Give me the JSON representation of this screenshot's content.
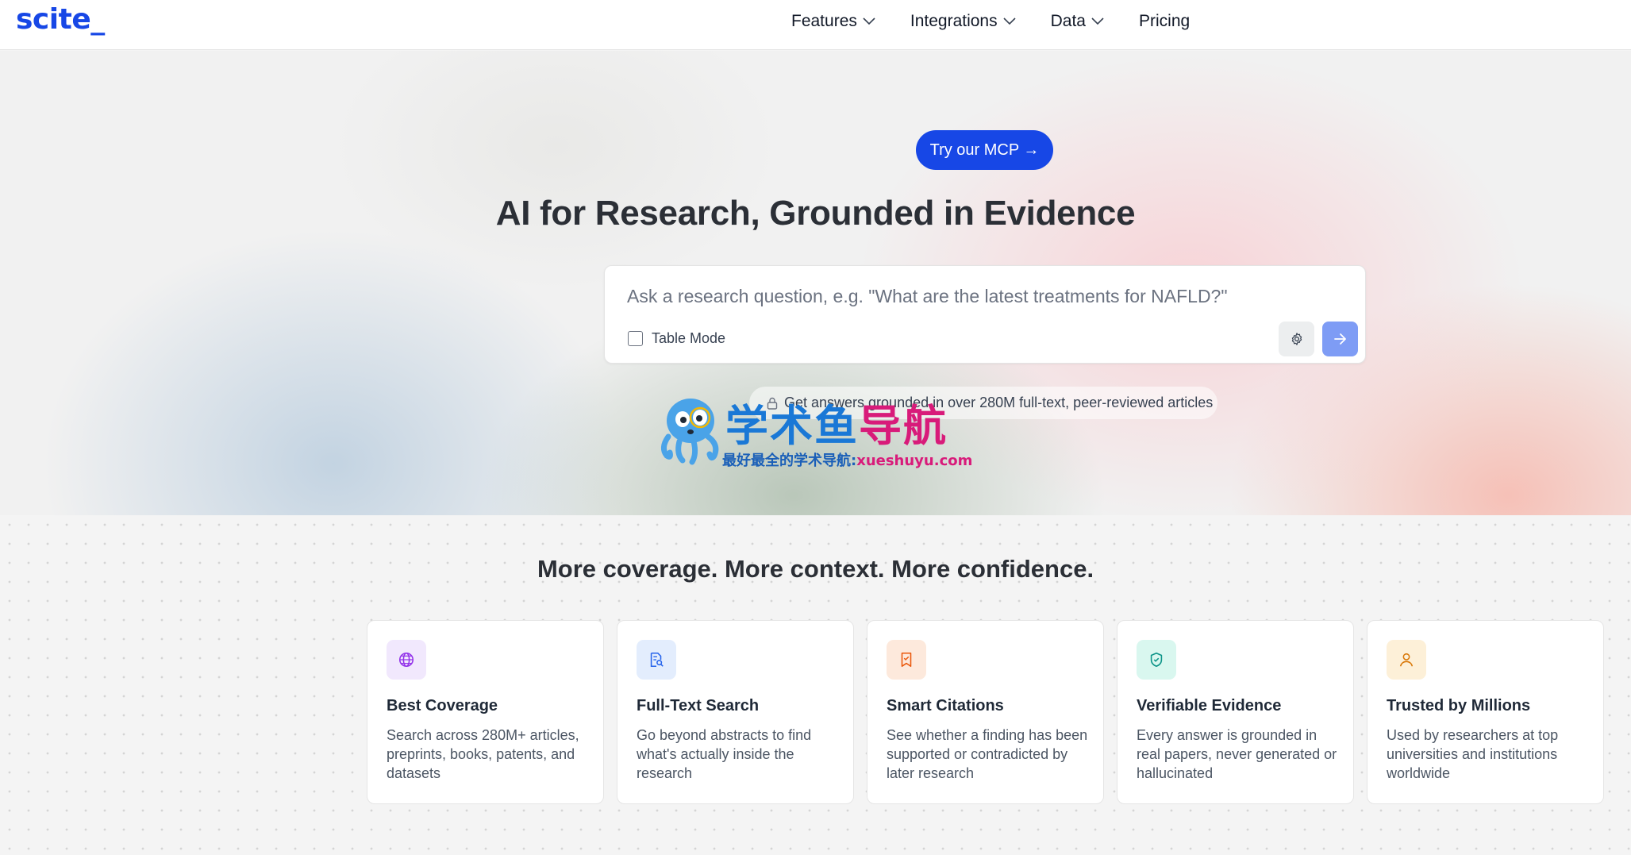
{
  "brand": {
    "logo": "scite_",
    "color": "#1747e6"
  },
  "nav": {
    "items": [
      {
        "label": "Features",
        "has_dropdown": true
      },
      {
        "label": "Integrations",
        "has_dropdown": true
      },
      {
        "label": "Data",
        "has_dropdown": true
      },
      {
        "label": "Pricing",
        "has_dropdown": false
      }
    ]
  },
  "hero": {
    "cta_label": "Try our MCP →",
    "title": "AI for Research, Grounded in Evidence",
    "search": {
      "value": "",
      "placeholder": "Ask a research question, e.g. \"What are the latest treatments for NAFLD?\""
    },
    "table_mode_label": "Table Mode",
    "table_mode_checked": false,
    "settings_icon": "gear-icon",
    "submit_icon": "arrow-right-icon",
    "grounded_text": "Get answers grounded in over 280M full-text, peer-reviewed articles"
  },
  "watermark": {
    "title_blue": "学术鱼",
    "title_pink": "导航",
    "subtitle": "最好最全的学术导航:",
    "subtitle_pink": "xueshuyu.com"
  },
  "features": {
    "title": "More coverage. More context. More confidence.",
    "cards": [
      {
        "icon": "globe-icon",
        "icon_bg": "#f1e8fd",
        "icon_color": "#9333ea",
        "title": "Best Coverage",
        "desc": "Search across 280M+ articles, preprints, books, patents, and datasets"
      },
      {
        "icon": "document-search-icon",
        "icon_bg": "#e3edfd",
        "icon_color": "#2563eb",
        "title": "Full-Text Search",
        "desc": "Go beyond abstracts to find what's actually inside the research"
      },
      {
        "icon": "bookmark-citation-icon",
        "icon_bg": "#fde9dc",
        "icon_color": "#ea580c",
        "title": "Smart Citations",
        "desc": "See whether a finding has been supported or contradicted by later research"
      },
      {
        "icon": "shield-check-icon",
        "icon_bg": "#d9f7ef",
        "icon_color": "#0d9488",
        "title": "Verifiable Evidence",
        "desc": "Every answer is grounded in real papers, never generated or hallucinated"
      },
      {
        "icon": "user-icon",
        "icon_bg": "#fdf0d8",
        "icon_color": "#d97706",
        "title": "Trusted by Millions",
        "desc": "Used by researchers at top universities and institutions worldwide"
      }
    ]
  }
}
